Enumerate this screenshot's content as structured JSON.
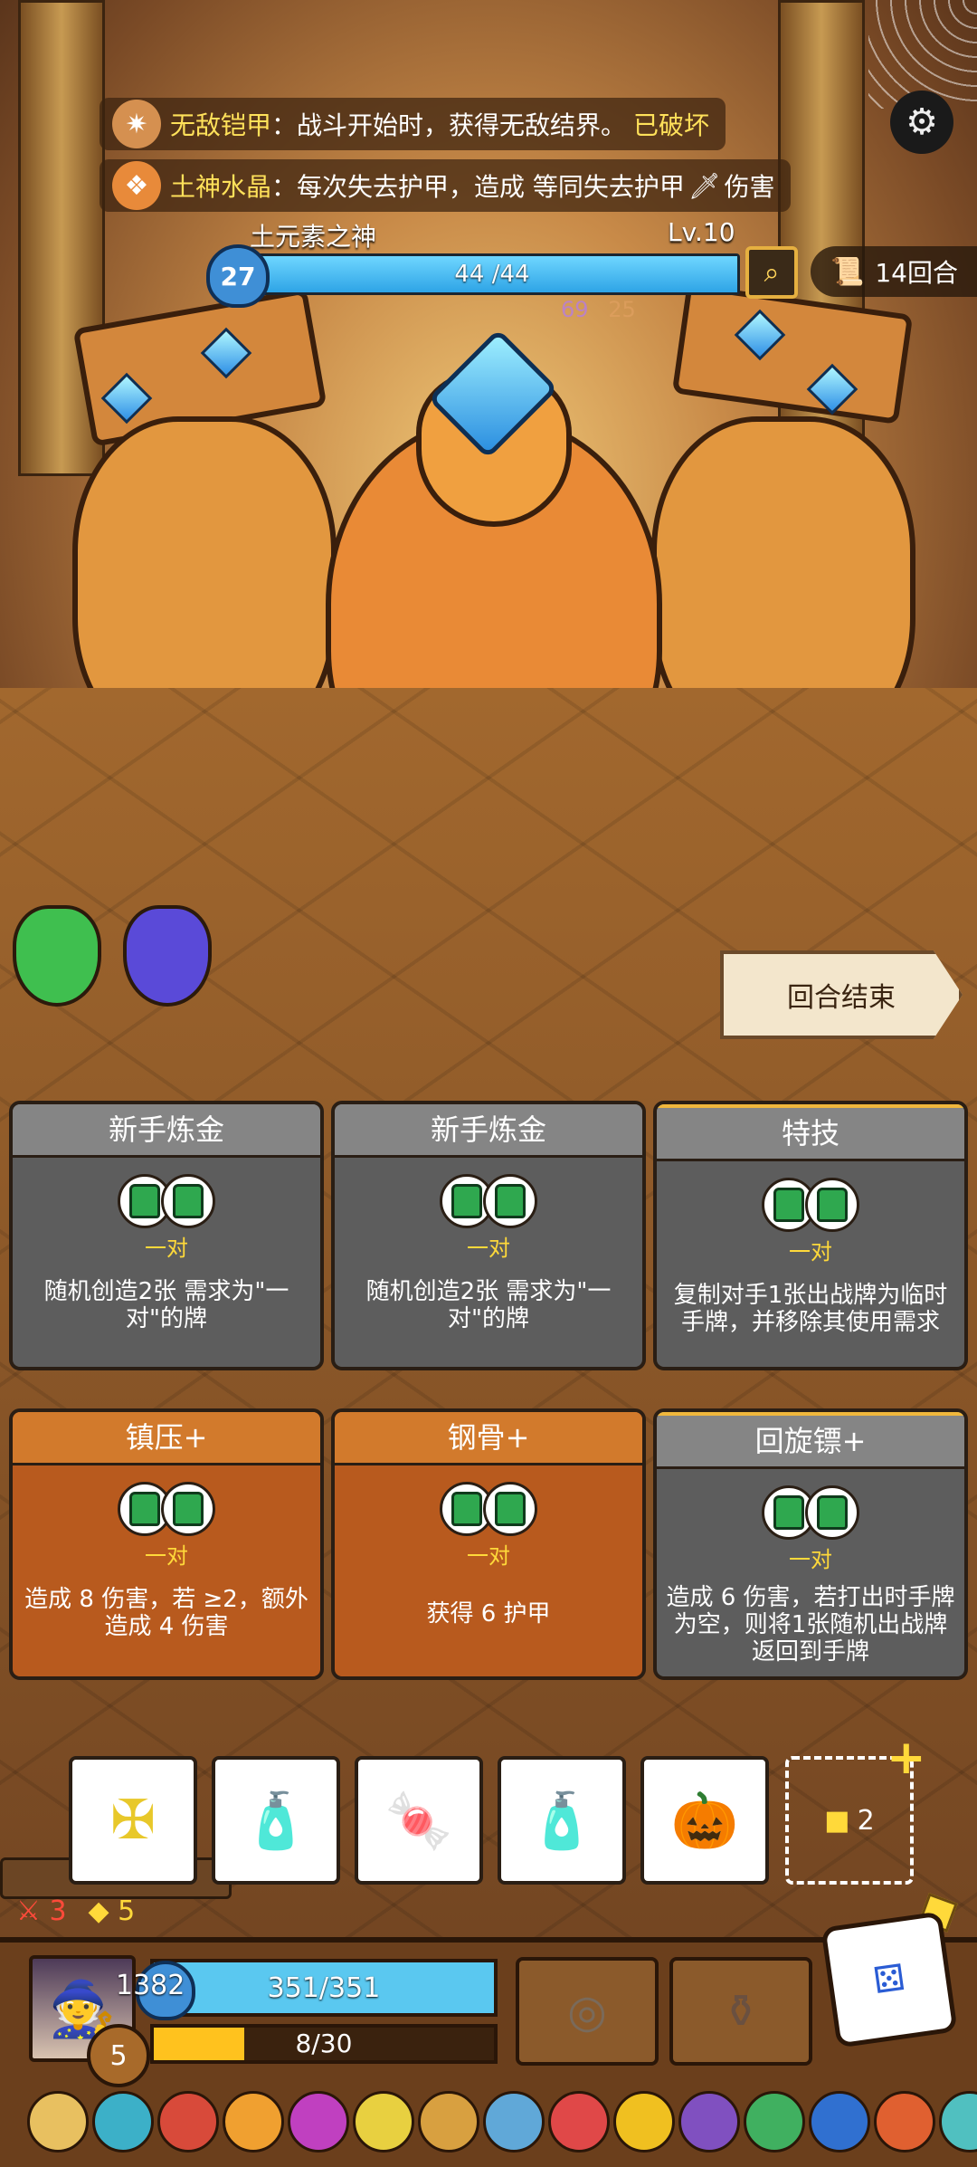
{
  "buffs": [
    {
      "name": "无敌铠甲",
      "text": "：战斗开始时，获得无敌结界。",
      "status": "已破坏"
    },
    {
      "name": "土神水晶",
      "text": "：每次失去护甲，造成 等同失去护甲",
      "suffix": "伤害"
    }
  ],
  "boss": {
    "name": "土元素之神",
    "level": "Lv.10",
    "armor": "27",
    "hp_text": "44 /44",
    "hp_fraction": 1.0,
    "intent_values": [
      "69",
      "25"
    ]
  },
  "turn": {
    "label": "14回合"
  },
  "end_turn_label": "回合结束",
  "cards": [
    {
      "title": "新手炼金",
      "req": "一对",
      "desc": "随机创造2张 需求为\"一对\"的牌",
      "style": "gray"
    },
    {
      "title": "新手炼金",
      "req": "一对",
      "desc": "随机创造2张 需求为\"一对\"的牌",
      "style": "gray"
    },
    {
      "title": "特技",
      "req": "一对",
      "desc": "复制对手1张出战牌为临时手牌，并移除其使用需求",
      "style": "mixed"
    },
    {
      "title": "镇压+",
      "req": "一对",
      "desc": "造成 8 伤害，若 ≥2，额外造成 4 伤害",
      "style": "orange"
    },
    {
      "title": "钢骨+",
      "req": "一对",
      "desc": "获得 6 护甲",
      "style": "orange"
    },
    {
      "title": "回旋镖+",
      "req": "一对",
      "desc": "造成 6 伤害，若打出时手牌为空，则将1张随机出战牌返回到手牌",
      "style": "mixed"
    }
  ],
  "hand": {
    "items": [
      "cross-icon",
      "potion-icon",
      "candy-icon",
      "potion-icon",
      "pumpkin-icon"
    ],
    "empty_slot_count": "2"
  },
  "counters": {
    "red": "3",
    "yellow": "5"
  },
  "player": {
    "gold": "1382",
    "hp_text": "351/351",
    "xp_text": "8/30",
    "xp_fraction": 0.267,
    "level": "5"
  },
  "colors": {
    "accent": "#ffd93a",
    "hp": "#5ac8f0",
    "boss_hp": "#2ea4e6"
  }
}
